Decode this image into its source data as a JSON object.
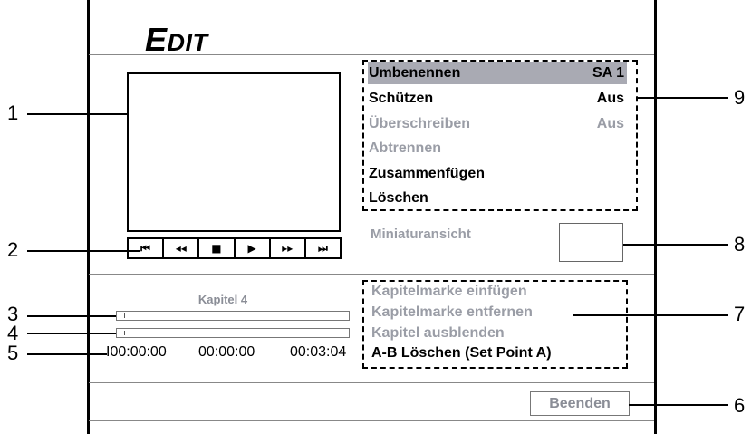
{
  "screen": {
    "title_first": "E",
    "title_rest": "DIT"
  },
  "player": {
    "controls": [
      {
        "icon": "skip-start-icon",
        "glyph": "⏮"
      },
      {
        "icon": "rewind-icon",
        "glyph": "◂◂"
      },
      {
        "icon": "stop-icon",
        "glyph": "■"
      },
      {
        "icon": "play-icon",
        "glyph": "▶"
      },
      {
        "icon": "fast-forward-icon",
        "glyph": "▸▸"
      },
      {
        "icon": "skip-end-icon",
        "glyph": "⏭"
      }
    ]
  },
  "menu": {
    "items": [
      {
        "label": "Umbenennen",
        "value": "SA 1",
        "state": "selected"
      },
      {
        "label": "Schützen",
        "value": "Aus",
        "state": "enabled"
      },
      {
        "label": "Überschreiben",
        "value": "Aus",
        "state": "disabled"
      },
      {
        "label": "Abtrennen",
        "value": "",
        "state": "disabled"
      },
      {
        "label": "Zusammenfügen",
        "value": "",
        "state": "enabled"
      },
      {
        "label": "Löschen",
        "value": "",
        "state": "enabled"
      }
    ]
  },
  "thumbnail": {
    "label": "Miniaturansicht"
  },
  "chapter": {
    "label": "Kapitel 4",
    "timecodes": [
      "I00:00:00",
      "00:00:00",
      "00:03:04"
    ],
    "items": [
      {
        "label": "Kapitelmarke einfügen",
        "state": "disabled"
      },
      {
        "label": "Kapitelmarke entfernen",
        "state": "disabled"
      },
      {
        "label": "Kapitel ausblenden",
        "state": "disabled"
      },
      {
        "label": "A-B Löschen (Set Point A)",
        "state": "enabled"
      }
    ]
  },
  "footer": {
    "exit_label": "Beenden"
  },
  "callouts": [
    "1",
    "2",
    "3",
    "4",
    "5",
    "6",
    "7",
    "8",
    "9"
  ],
  "colors": {
    "selected_bg": "#a9aab3",
    "disabled_text": "#9a9da6",
    "frame": "#000000"
  }
}
